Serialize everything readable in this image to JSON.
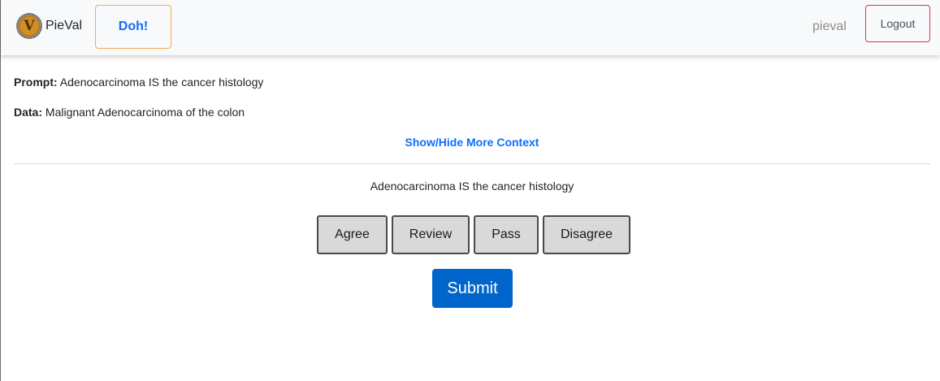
{
  "navbar": {
    "brand_logo_letter": "V",
    "brand_name": "PieVal",
    "doh_label": "Doh!",
    "username": "pieval",
    "logout_label": "Logout"
  },
  "prompt": {
    "label": "Prompt:",
    "text": "Adenocarcinoma IS the cancer histology"
  },
  "data": {
    "label": "Data:",
    "text": "Malignant Adenocarcinoma of the colon"
  },
  "context_link": "Show/Hide More Context",
  "question": "Adenocarcinoma IS the cancer histology",
  "choices": {
    "agree": "Agree",
    "review": "Review",
    "pass": "Pass",
    "disagree": "Disagree"
  },
  "submit_label": "Submit",
  "colors": {
    "link": "#0d6efd",
    "submit_bg": "#0066cc",
    "doh_border": "#f0ad4e",
    "logout_border": "#dc3545"
  }
}
